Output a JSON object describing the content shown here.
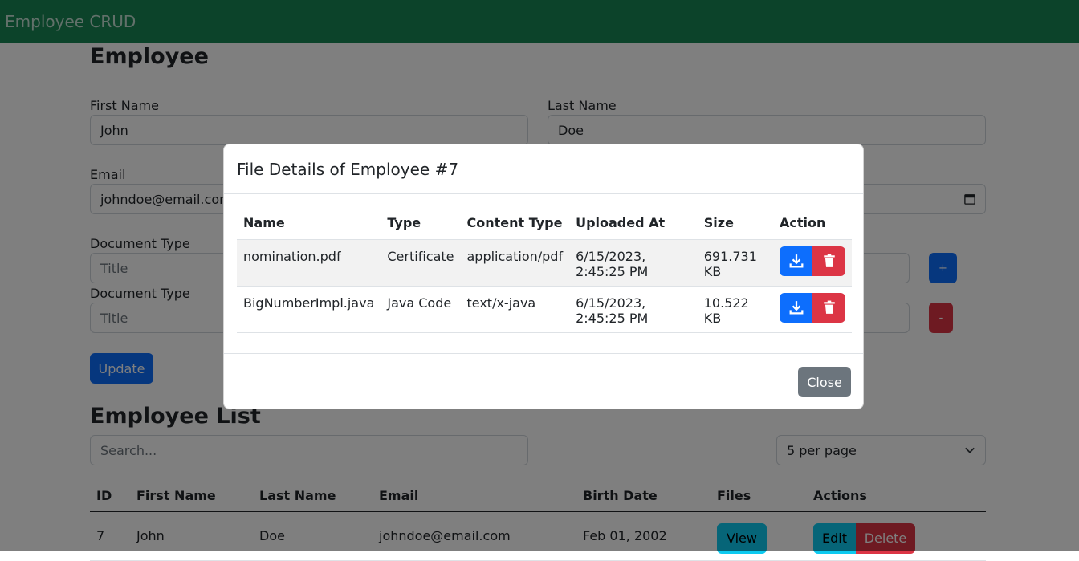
{
  "app": {
    "brand": "Employee CRUD"
  },
  "form": {
    "title": "Employee",
    "first_name_label": "First Name",
    "first_name_value": "John",
    "last_name_label": "Last Name",
    "last_name_value": "Doe",
    "email_label": "Email",
    "email_value": "johndoe@email.com",
    "documents": [
      {
        "label": "Document Type",
        "placeholder": "Title",
        "action_label": "+"
      },
      {
        "label": "Document Type",
        "placeholder": "Title",
        "action_label": "-"
      }
    ],
    "update_label": "Update"
  },
  "list": {
    "title": "Employee List",
    "search_placeholder": "Search...",
    "per_page": "5 per page",
    "columns": [
      "ID",
      "First Name",
      "Last Name",
      "Email",
      "Birth Date",
      "Files",
      "Actions"
    ],
    "rows": [
      {
        "id": "7",
        "first": "John",
        "last": "Doe",
        "email": "johndoe@email.com",
        "birth": "Feb 01, 2002",
        "view": "View",
        "edit": "Edit",
        "delete": "Delete"
      }
    ]
  },
  "modal": {
    "title": "File Details of Employee #7",
    "columns": [
      "Name",
      "Type",
      "Content Type",
      "Uploaded At",
      "Size",
      "Action"
    ],
    "files": [
      {
        "name": "nomination.pdf",
        "type": "Certificate",
        "content_type": "application/pdf",
        "uploaded_at": "6/15/2023, 2:45:25 PM",
        "size": "691.731 KB"
      },
      {
        "name": "BigNumberImpl.java",
        "type": "Java Code",
        "content_type": "text/x-java",
        "uploaded_at": "6/15/2023, 2:45:25 PM",
        "size": "10.522 KB"
      }
    ],
    "close_label": "Close"
  },
  "icons": {
    "download": "download-icon",
    "trash": "trash-icon",
    "calendar": "calendar-icon",
    "chevron": "chevron-down-icon"
  },
  "colors": {
    "navbar": "#198754",
    "primary": "#0d6efd",
    "danger": "#dc3545",
    "info": "#0dcaf0",
    "secondary": "#6c757d"
  }
}
